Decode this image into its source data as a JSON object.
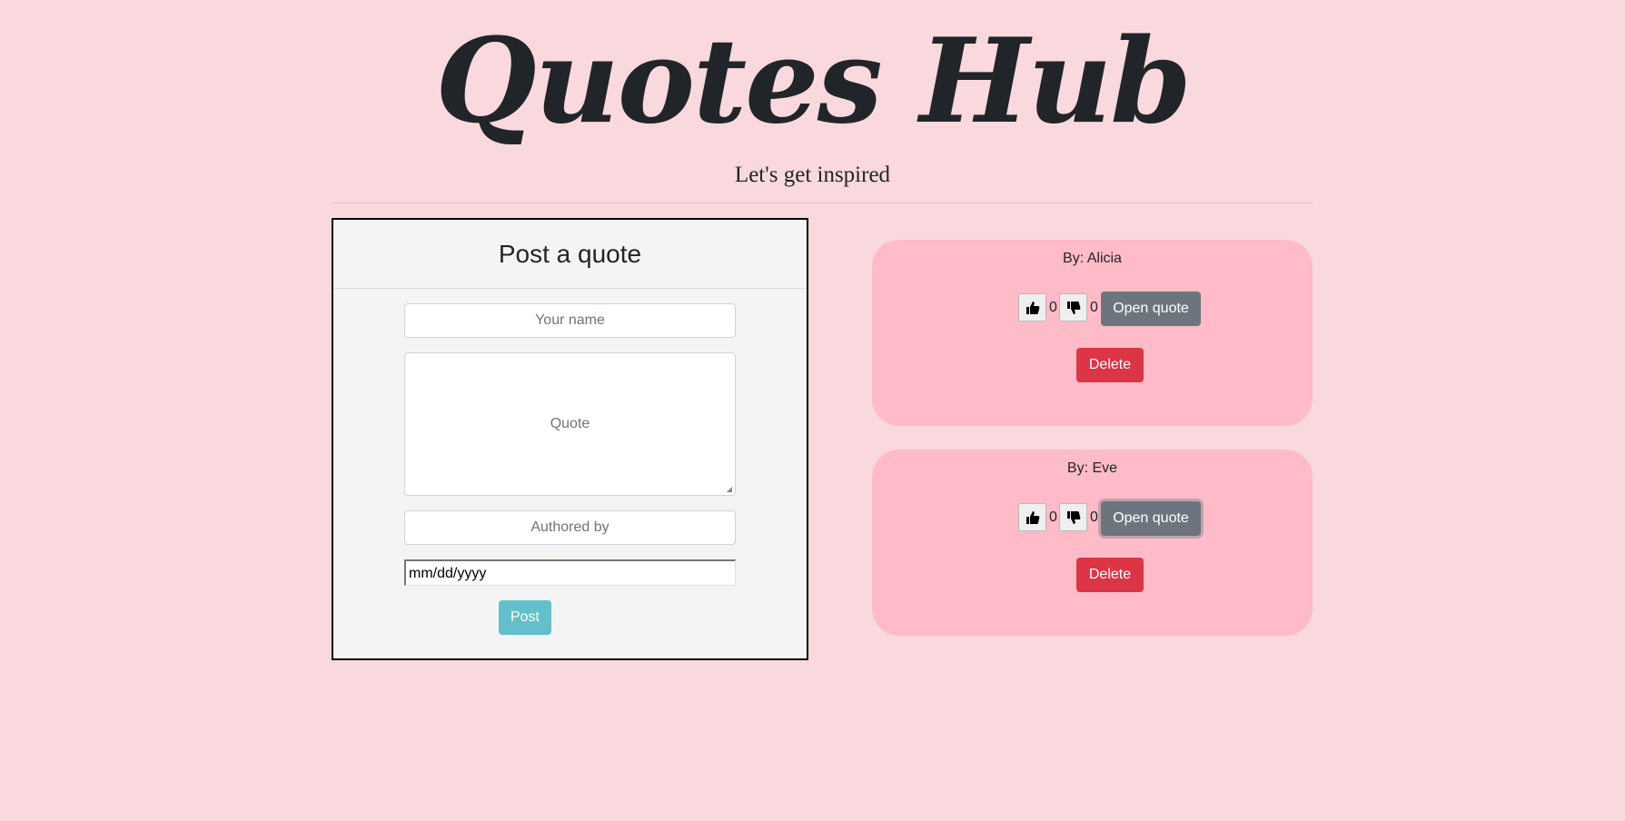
{
  "header": {
    "title": "Quotes Hub",
    "tagline": "Let's get inspired"
  },
  "post_form": {
    "heading": "Post a quote",
    "name_placeholder": "Your name",
    "quote_placeholder": "Quote",
    "author_placeholder": "Authored by",
    "date_placeholder": "mm/dd/yyyy",
    "submit_label": "Post"
  },
  "quotes": [
    {
      "by": "By: Alicia",
      "upvotes": "0",
      "downvotes": "0",
      "open_label": "Open quote",
      "delete_label": "Delete"
    },
    {
      "by": "By: Eve",
      "upvotes": "0",
      "downvotes": "0",
      "open_label": "Open quote",
      "delete_label": "Delete"
    }
  ],
  "icons": {
    "upvote": "thumbs-up-icon",
    "downvote": "thumbs-down-icon"
  },
  "colors": {
    "background": "#f9d9dd",
    "card": "#ffbbc7",
    "form_panel": "#f4f4f4",
    "post_button": "#62bfcb",
    "open_button": "#6c757d",
    "delete_button": "#dc3545"
  }
}
